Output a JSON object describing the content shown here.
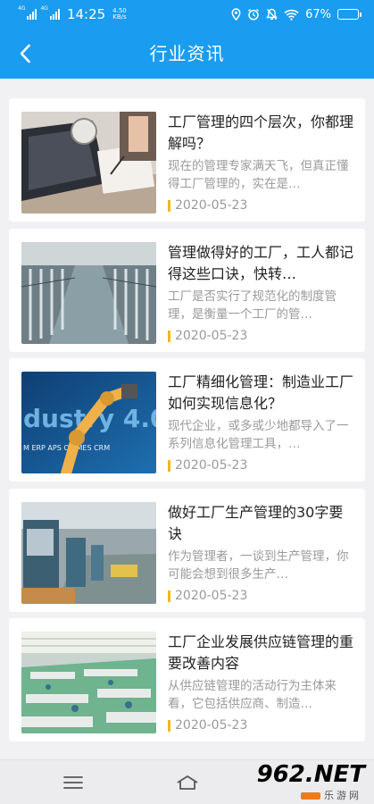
{
  "status_bar": {
    "sim1": "4G",
    "sim2": "4G",
    "time": "14:25",
    "net_speed_value": "4.50",
    "net_speed_unit": "KB/s",
    "battery_percent": "67%",
    "battery_level": 0.67
  },
  "header": {
    "title": "行业资讯",
    "back_icon": "chevron-left-icon",
    "color": "#1a9cf0"
  },
  "articles": [
    {
      "title": "工厂管理的四个层次，你都理解吗？",
      "summary": "现在的管理专家满天飞，但真正懂得工厂管理的，实在是…",
      "date": "2020-05-23",
      "image": "laptop-desk-photo"
    },
    {
      "title": "管理做得好的工厂，工人都记得这些口诀，快转…",
      "summary": "工厂是否实行了规范化的制度管理，是衡量一个工厂的管…",
      "date": "2020-05-23",
      "image": "textile-factory-photo"
    },
    {
      "title": "工厂精细化管理：制造业工厂如何实现信息化？",
      "summary": "现代企业，或多或少地都导入了一系列信息化管理工具，…",
      "date": "2020-05-23",
      "image": "robot-arm-industry40-photo",
      "image_text": "dustry 4.0",
      "image_tags": "M ERP APS OA     MES CRM"
    },
    {
      "title": "做好工厂生产管理的30字要诀",
      "summary": "作为管理者，一谈到生产管理，你可能会想到很多生产…",
      "date": "2020-05-23",
      "image": "machine-workshop-photo"
    },
    {
      "title": "工厂企业发展供应链管理的重要改善内容",
      "summary": "从供应链管理的活动行为主体来看，它包括供应商、制造…",
      "date": "2020-05-23",
      "image": "assembly-line-photo"
    }
  ],
  "bottom_nav": {
    "menu_icon": "menu-icon",
    "home_icon": "home-icon"
  },
  "watermark": {
    "brand": "962.NET",
    "subtitle": "乐游网"
  }
}
